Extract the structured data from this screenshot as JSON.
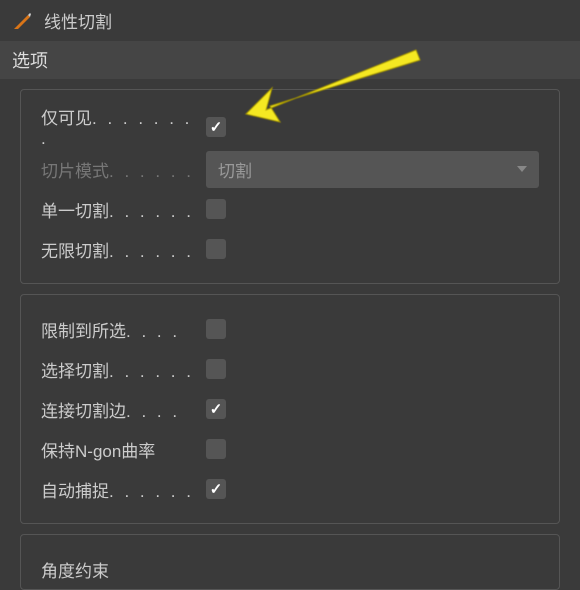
{
  "header": {
    "title": "线性切割"
  },
  "section": {
    "title": "选项"
  },
  "panel1": {
    "visible_only": {
      "label": "仅可见",
      "dots": ". . . . . . . .",
      "checked": true
    },
    "slice_mode": {
      "label": "切片模式",
      "dots": ". . . . . .",
      "value": "切割",
      "disabled": true
    },
    "single_cut": {
      "label": "单一切割",
      "dots": ". . . . . .",
      "checked": false
    },
    "infinite_cut": {
      "label": "无限切割",
      "dots": ". . . . . .",
      "checked": false
    }
  },
  "panel2": {
    "restrict_selection": {
      "label": "限制到所选",
      "dots": ". . . .",
      "checked": false
    },
    "select_cut": {
      "label": "选择切割",
      "dots": ". . . . . .",
      "checked": false
    },
    "connect_cut_edges": {
      "label": "连接切割边",
      "dots": ". . . .",
      "checked": true
    },
    "preserve_ngon": {
      "label": "保持N-gon曲率",
      "checked": false
    },
    "auto_snap": {
      "label": "自动捕捉",
      "dots": ". . . . . .",
      "checked": true
    }
  },
  "panel3": {
    "angle_constraint": {
      "label": "角度约束"
    }
  }
}
